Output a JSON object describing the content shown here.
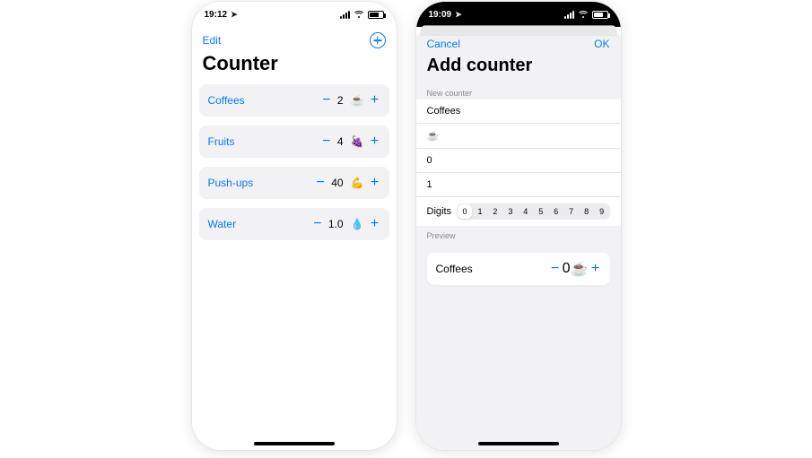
{
  "phone1": {
    "status_time": "19:12",
    "edit_label": "Edit",
    "title": "Counter",
    "counters": [
      {
        "name": "Coffees",
        "value": "2",
        "emoji": "☕️"
      },
      {
        "name": "Fruits",
        "value": "4",
        "emoji": "🍇"
      },
      {
        "name": "Push-ups",
        "value": "40",
        "emoji": "💪"
      },
      {
        "name": "Water",
        "value": "1.0",
        "emoji": "💧"
      }
    ]
  },
  "phone2": {
    "status_time": "19:09",
    "cancel_label": "Cancel",
    "ok_label": "OK",
    "title": "Add counter",
    "section_new": "New counter",
    "form": {
      "name": "Coffees",
      "emoji": "☕️",
      "initial": "0",
      "step": "1",
      "digits_label": "Digits",
      "digits_options": [
        "0",
        "1",
        "2",
        "3",
        "4",
        "5",
        "6",
        "7",
        "8",
        "9"
      ],
      "digits_selected": "0"
    },
    "section_preview": "Preview",
    "preview": {
      "name": "Coffees",
      "value": "0",
      "emoji": "☕️"
    }
  },
  "glyphs": {
    "minus": "−",
    "plus": "+"
  }
}
